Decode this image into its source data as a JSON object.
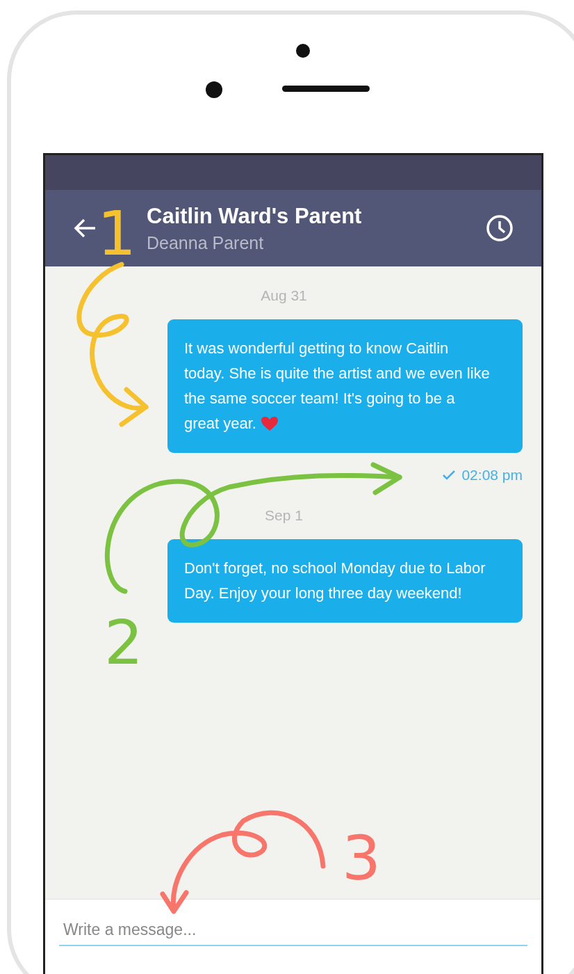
{
  "header": {
    "title": "Caitlin Ward's Parent",
    "subtitle": "Deanna Parent"
  },
  "messages": [
    {
      "date": "Aug 31",
      "text": "It was wonderful getting to know Caitlin today. She is quite the artist and we even like the same soccer team! It's going to be a great year.",
      "heart": true,
      "time": "02:08 pm"
    },
    {
      "date": "Sep 1",
      "text": "Don't forget, no school Monday due to Labor Day. Enjoy your long three day weekend!",
      "heart": false
    }
  ],
  "composer": {
    "placeholder": "Write a message..."
  },
  "annotations": [
    {
      "label": "1",
      "color": "#f5c12e"
    },
    {
      "label": "2",
      "color": "#7cc242"
    },
    {
      "label": "3",
      "color": "#f7756a"
    }
  ]
}
